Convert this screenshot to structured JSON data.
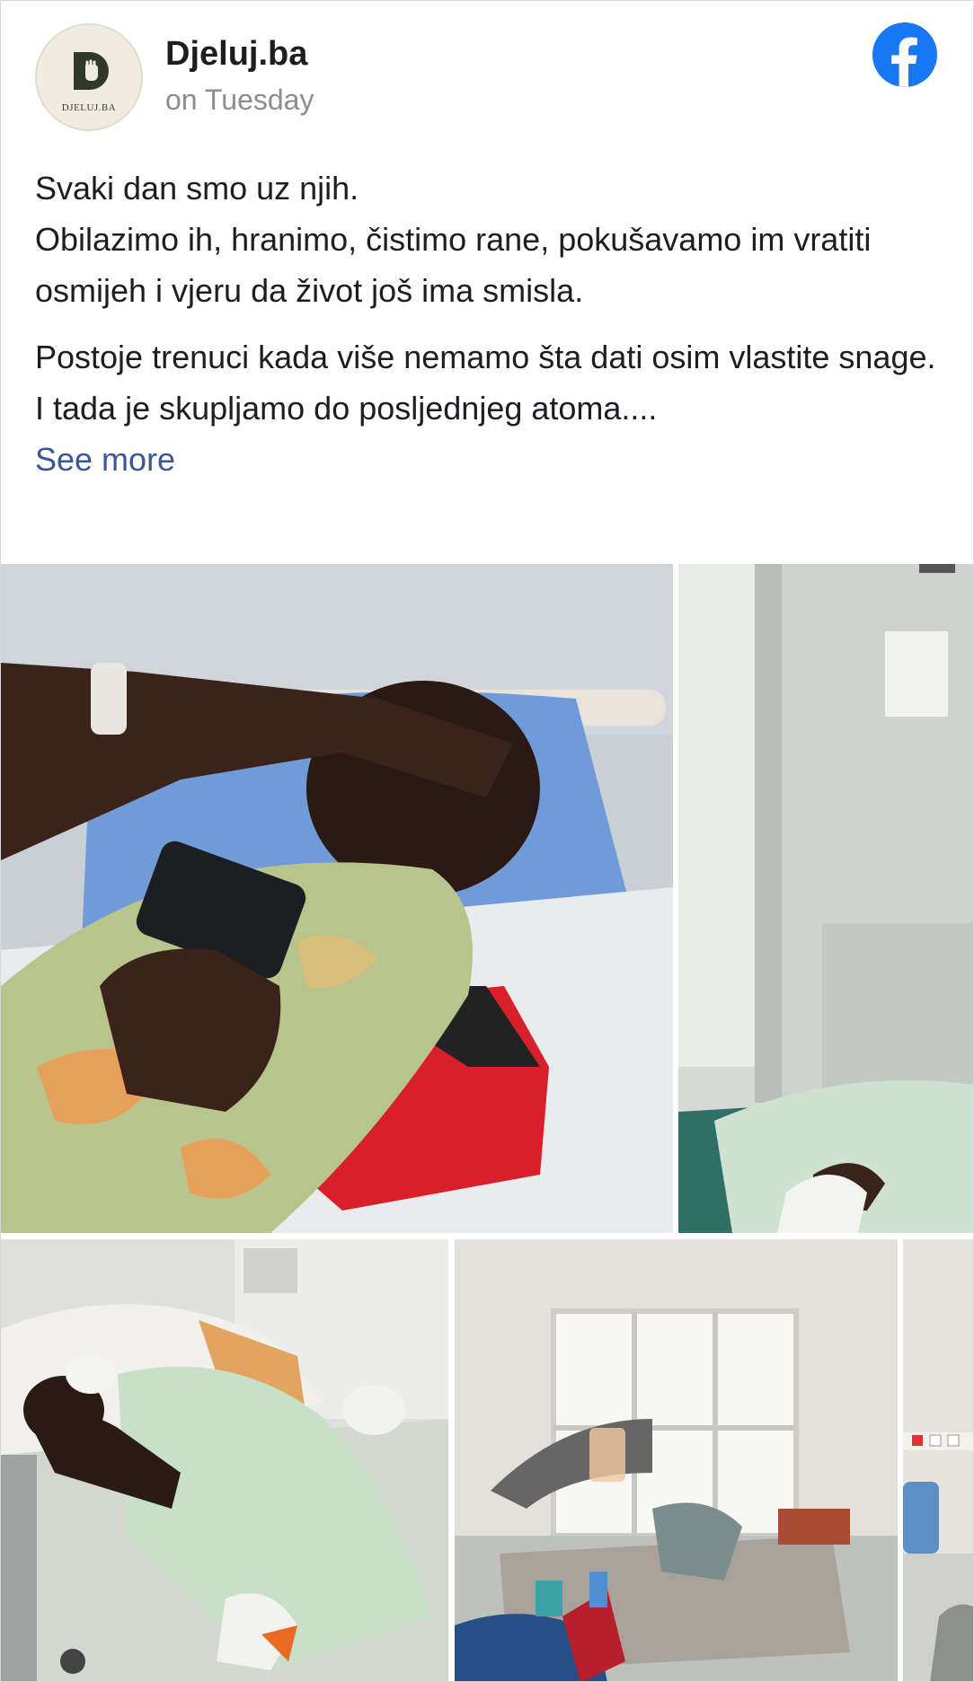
{
  "post": {
    "page_name": "Djeluj.ba",
    "time": "on Tuesday",
    "avatar": {
      "logo_text": "DJELUJ.BA",
      "logo_letter": "D"
    },
    "paragraphs": [
      [
        "Svaki dan smo uz njih.",
        "Obilazimo ih, hranimo, čistimo rane, pokušavamo im vratiti osmijeh i vjeru da život još ima smisla."
      ],
      [
        "Postoje trenuci kada više nemamo šta dati osim vlastite snage.",
        "I tada je skupljamo do posljednjeg atoma...."
      ]
    ],
    "see_more": "See more",
    "brand_icon": "facebook-icon",
    "colors": {
      "facebook_blue": "#1877f2",
      "link": "#385898",
      "muted": "#8a8d91"
    }
  },
  "photos": [
    {
      "name": "photo-patient-with-phone",
      "icon": "image"
    },
    {
      "name": "photo-hospital-door",
      "icon": "image"
    },
    {
      "name": "photo-patient-lying-bandaged",
      "icon": "image"
    },
    {
      "name": "photo-hospital-room-window",
      "icon": "image"
    },
    {
      "name": "photo-hospital-room-partial",
      "icon": "image"
    }
  ]
}
